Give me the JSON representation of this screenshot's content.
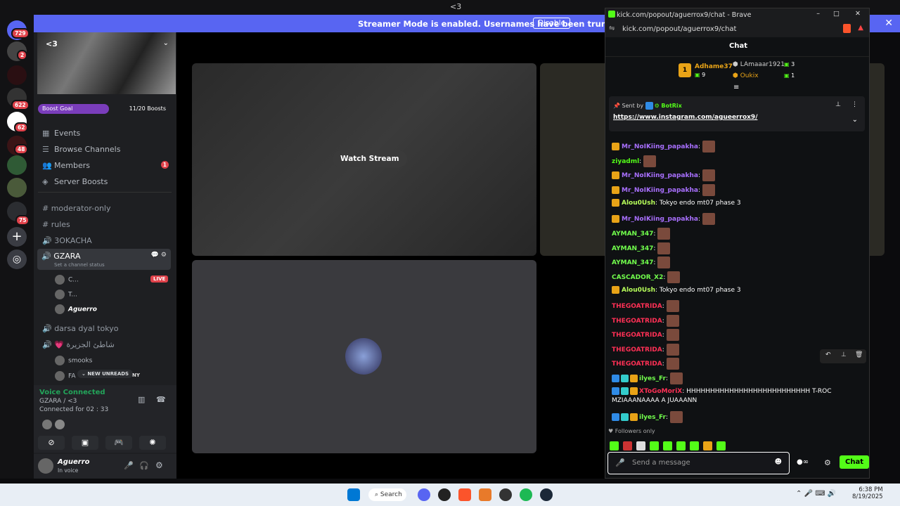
{
  "topbar": {
    "title": "<3"
  },
  "banner": {
    "text": "Streamer Mode is enabled. Usernames have been truncated.",
    "button": "Disable"
  },
  "servers": {
    "badges": [
      "729",
      "2",
      "622",
      "62",
      "48",
      "75"
    ]
  },
  "guild": {
    "name": "<3",
    "boost_label": "Boost Goal",
    "boost_count": "11/20 Boosts"
  },
  "nav": [
    {
      "label": "Events",
      "icon": "calendar-icon"
    },
    {
      "label": "Browse Channels",
      "icon": "browse-icon"
    },
    {
      "label": "Members",
      "icon": "members-icon",
      "badge": "1"
    },
    {
      "label": "Server Boosts",
      "icon": "boost-icon"
    }
  ],
  "channels": {
    "c1": "moderator-only",
    "c2": "rules",
    "c3": "3OKACHA",
    "gzara": "GZARA",
    "status": "Set a channel status",
    "u1": "C...",
    "live": "LIVE",
    "u2": "T...",
    "u3": "Aguerro",
    "c4": "darsa dyal tokyo",
    "c5": "شاطئ الجزيرة",
    "u4": "smooks",
    "u5": "FA",
    "new_unreads": "NEW UNREADS",
    "ny": "NY"
  },
  "voice": {
    "title": "Voice Connected",
    "channel": "GZARA / <3",
    "time": "Connected for 02 : 33"
  },
  "user": {
    "name": "Aguerro",
    "status": "In voice"
  },
  "stream": {
    "watch": "Watch Stream"
  },
  "browser": {
    "title": "kick.com/popout/aguerrox9/chat - Brave",
    "url": "kick.com/popout/aguerrox9/chat"
  },
  "chat": {
    "header": "Chat",
    "leader1": {
      "rank": "1",
      "name": "Adhame37",
      "count": "9"
    },
    "leader2": {
      "name": "LAmaaar1921",
      "count": "3"
    },
    "leader3": {
      "name": "Oukix",
      "count": "1"
    },
    "pinned": {
      "sent_by": "Sent by",
      "bot": "BotRix",
      "link": "https://www.instagram.com/agueerrox9/"
    },
    "messages": [
      {
        "user": "Mr_NoIKiing_papakha",
        "color": "#a970ff",
        "text": "",
        "emote": true,
        "crown": true
      },
      {
        "user": "ziyadml",
        "color": "#53fc18",
        "text": "",
        "emote": true
      },
      {
        "user": "Mr_NoIKiing_papakha",
        "color": "#a970ff",
        "text": "",
        "emote": true,
        "crown": true
      },
      {
        "user": "Mr_NoIKiing_papakha",
        "color": "#a970ff",
        "text": "",
        "emote": true,
        "crown": true
      },
      {
        "user": "Alou0Ush",
        "color": "#b7ff5a",
        "text": "Tokyo endo mt07 phase 3",
        "emote": false,
        "crown": true
      },
      {
        "user": "Mr_NoIKiing_papakha",
        "color": "#a970ff",
        "text": "",
        "emote": true,
        "crown": true
      },
      {
        "user": "AYMAN_347",
        "color": "#72ff4d",
        "text": "",
        "emote": true
      },
      {
        "user": "AYMAN_347",
        "color": "#72ff4d",
        "text": "",
        "emote": true
      },
      {
        "user": "AYMAN_347",
        "color": "#72ff4d",
        "text": "",
        "emote": true
      },
      {
        "user": "CASCADOR_X2",
        "color": "#72ff4d",
        "text": "",
        "emote": true
      },
      {
        "user": "Alou0Ush",
        "color": "#b7ff5a",
        "text": "Tokyo endo mt07 phase 3",
        "emote": false,
        "crown": true
      },
      {
        "user": "THEGOATRIDA",
        "color": "#ff3055",
        "text": "",
        "emote": true
      },
      {
        "user": "THEGOATRIDA",
        "color": "#ff3055",
        "text": "",
        "emote": true
      },
      {
        "user": "THEGOATRIDA",
        "color": "#ff3055",
        "text": "",
        "emote": true
      },
      {
        "user": "THEGOATRIDA",
        "color": "#ff3055",
        "text": "",
        "emote": true
      },
      {
        "user": "THEGOATRIDA",
        "color": "#ff3055",
        "text": "",
        "emote": true
      },
      {
        "user": "ilyes_Fr",
        "color": "#72ff4d",
        "text": "",
        "emote": true
      },
      {
        "user": "XToGoMoriX",
        "color": "#ff3055",
        "text": "HHHHHHHHHHHHHHHHHHHHHHHHHH T-ROC",
        "emote": false
      },
      {
        "user": "",
        "color": "#fff",
        "text": "MZIAAANAAAA A JUAAANN",
        "emote": false
      },
      {
        "user": "ilyes_Fr",
        "color": "#72ff4d",
        "text": "",
        "emote": true
      }
    ],
    "followers_only": "Followers only",
    "placeholder": "Send a message",
    "send": "Chat"
  },
  "taskbar": {
    "search": "Search",
    "time": "6:38 PM",
    "date": "8/19/2025"
  }
}
